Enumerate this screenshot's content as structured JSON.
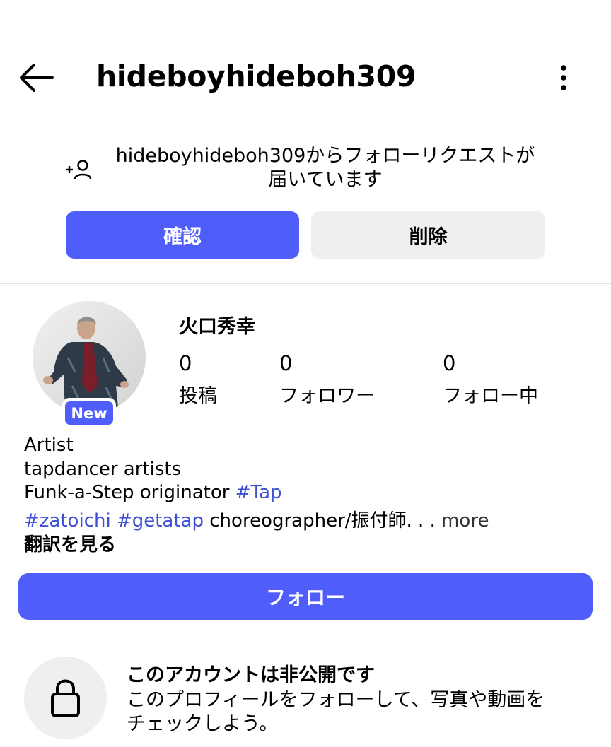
{
  "header": {
    "title": "hideboyhideboh309",
    "back_icon": "arrow-left-icon",
    "menu_icon": "more-vertical-icon"
  },
  "follow_request": {
    "icon": "add-person-icon",
    "line1": "hideboyhideboh309からフォローリクエストが",
    "line2": "届いています",
    "confirm_label": "確認",
    "delete_label": "削除"
  },
  "profile": {
    "badge": "New",
    "name": "火口秀幸",
    "stats": [
      {
        "value": "0",
        "label": "投稿"
      },
      {
        "value": "0",
        "label": "フォロワー"
      },
      {
        "value": "0",
        "label": "フォロー中"
      }
    ],
    "bio": {
      "line1": "Artist",
      "line2": "tapdancer artists",
      "line3_text": "Funk-a-Step originator ",
      "tag_tap": "#Tap",
      "tag_zatoichi": "#zatoichi",
      "tag_getatap": "#getatap",
      "line4_text": " choreographer/振付師. . . ",
      "more": "more"
    },
    "translate_label": "翻訳を見る",
    "follow_label": "フォロー"
  },
  "private": {
    "icon": "lock-icon",
    "title": "このアカウントは非公開です",
    "line1": "このプロフィールをフォローして、写真や動画を",
    "line2": "チェックしよう。"
  },
  "colors": {
    "accent": "#4f5dfb",
    "hashtag": "#3d4fd6",
    "secondary_button": "#efefef"
  }
}
